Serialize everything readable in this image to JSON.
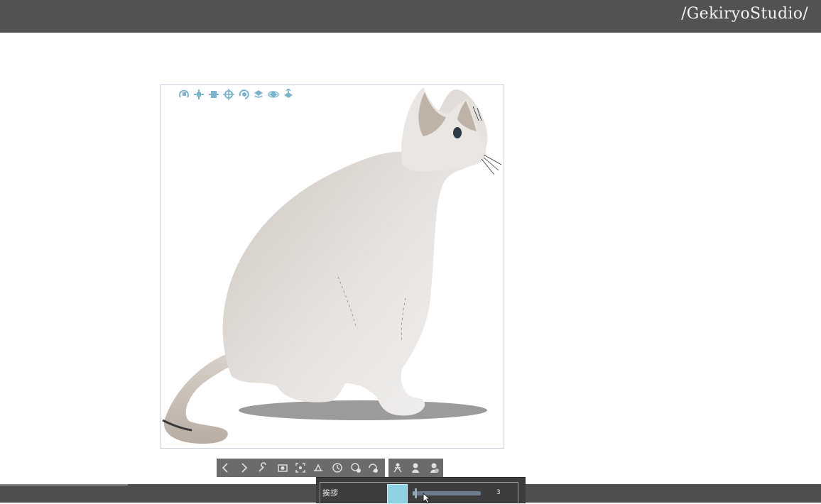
{
  "header": {
    "brand": "/GekiryoStudio/"
  },
  "canvas": {
    "object_manipulator_icons": [
      "rotate-camera-icon",
      "pan-camera-icon",
      "dolly-camera-icon",
      "move-object-icon",
      "rotate-object-icon",
      "rotate-object-ground-icon",
      "rotate-object-plane-icon",
      "move-object-plane-icon"
    ]
  },
  "sub_toolbar": {
    "group1": [
      "previous-icon",
      "next-icon",
      "wrench-icon",
      "camera-icon",
      "fit-view-icon",
      "ground-icon",
      "clock-icon",
      "settings-icon",
      "reset-icon"
    ],
    "group2": [
      "pose-icon",
      "figure-icon",
      "hand-icon"
    ]
  },
  "property_panel": {
    "label": "挨拶",
    "slider_value": "3",
    "slider_fraction": 0.03,
    "swatch_color": "#8fd2e3"
  },
  "colors": {
    "topbar": "#525252",
    "toolbar": "#6b6b6b",
    "accent_icon": "#7bb3cc"
  }
}
